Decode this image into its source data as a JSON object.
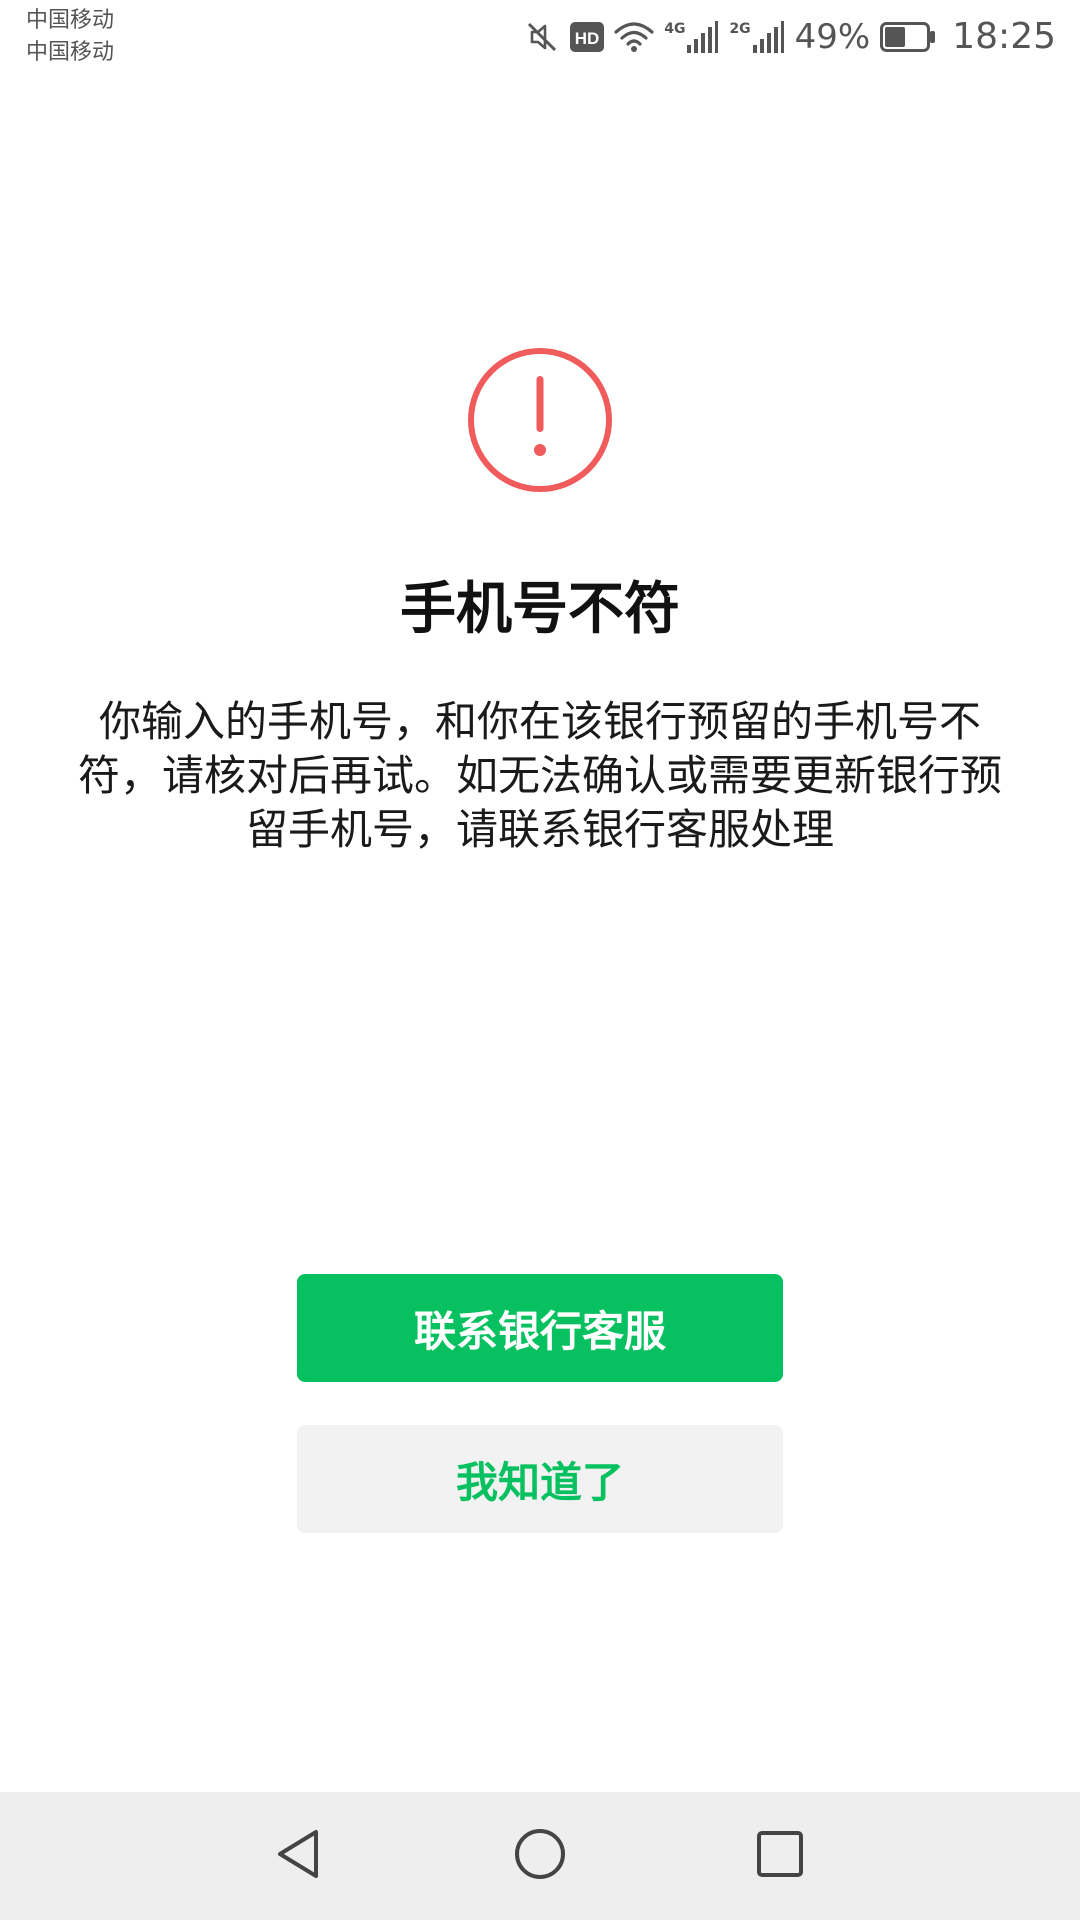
{
  "status_bar": {
    "carrier_1": "中国移动",
    "carrier_2": "中国移动",
    "hd_label": "HD",
    "network_1": "4G",
    "network_2": "2G",
    "battery_percent": "49%",
    "battery_level": 0.49,
    "time": "18:25",
    "icons": [
      "mute-icon",
      "hd-icon",
      "wifi-icon",
      "signal-icon",
      "signal-icon",
      "battery-icon"
    ]
  },
  "dialog": {
    "icon": "warning-icon",
    "icon_color": "#f05b5b",
    "title": "手机号不符",
    "description": "你输入的手机号，和你在该银行预留的手机号不符，请核对后再试。如无法确认或需要更新银行预留手机号，请联系银行客服处理"
  },
  "buttons": {
    "primary_label": "联系银行客服",
    "secondary_label": "我知道了",
    "accent_color": "#07c160"
  },
  "nav_bar": {
    "icons": [
      "back-icon",
      "home-icon",
      "recent-apps-icon"
    ]
  }
}
